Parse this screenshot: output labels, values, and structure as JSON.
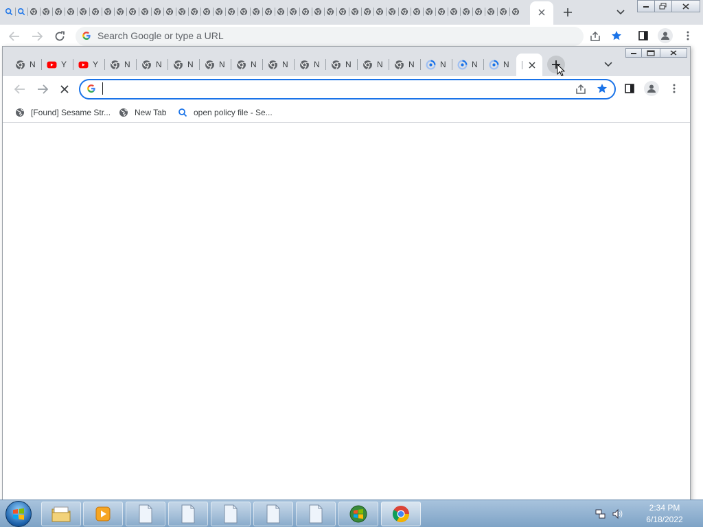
{
  "outer_window": {
    "tab_count_icons": 42,
    "omnibox_placeholder": "Search Google or type a URL"
  },
  "inner_window": {
    "tabs": [
      {
        "icon": "chrome-icon",
        "label": "N"
      },
      {
        "icon": "youtube-icon",
        "label": "Y"
      },
      {
        "icon": "youtube-icon",
        "label": "Y"
      },
      {
        "icon": "chrome-icon",
        "label": "N"
      },
      {
        "icon": "chrome-icon",
        "label": "N"
      },
      {
        "icon": "chrome-icon",
        "label": "N"
      },
      {
        "icon": "chrome-icon",
        "label": "N"
      },
      {
        "icon": "chrome-icon",
        "label": "N"
      },
      {
        "icon": "chrome-icon",
        "label": "N"
      },
      {
        "icon": "chrome-icon",
        "label": "N"
      },
      {
        "icon": "chrome-icon",
        "label": "N"
      },
      {
        "icon": "chrome-icon",
        "label": "N"
      },
      {
        "icon": "chrome-icon",
        "label": "N"
      },
      {
        "icon": "loading-icon",
        "label": "N"
      },
      {
        "icon": "loading-icon",
        "label": "N"
      },
      {
        "icon": "loading-icon",
        "label": "N"
      }
    ],
    "omnibox_value": "",
    "bookmarks": [
      {
        "icon": "globe-icon",
        "label": "[Found] Sesame Str..."
      },
      {
        "icon": "globe-icon",
        "label": "New Tab"
      },
      {
        "icon": "search-icon",
        "label": "open policy file - Se..."
      }
    ]
  },
  "taskbar": {
    "time": "2:34 PM",
    "date": "6/18/2022"
  },
  "colors": {
    "accent": "#1a73e8",
    "tabstrip": "#dee1e6",
    "youtube": "#ff0000"
  }
}
